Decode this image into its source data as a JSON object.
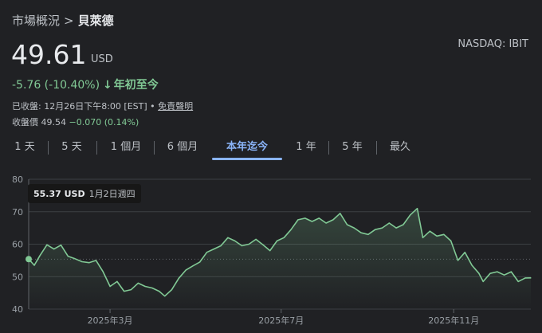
{
  "breadcrumb": {
    "root": "市場概況",
    "separator": ">",
    "current": "貝萊德"
  },
  "ticker": "NASDAQ: IBIT",
  "price": {
    "value": "49.61",
    "currency": "USD"
  },
  "change": {
    "text": "-5.76 (-10.40%)",
    "arrow": "↓",
    "period": "年初至今"
  },
  "closed": {
    "label": "已收盤:",
    "datetime": "12月26日下午8:00 [EST]",
    "separator": "•",
    "disclaimer": "免責聲明"
  },
  "after_hours": {
    "label": "收盤價",
    "value": "49.54",
    "delta": "−0.070 (0.14%)"
  },
  "tabs": [
    {
      "label": "1 天",
      "active": false
    },
    {
      "label": "5 天",
      "active": false
    },
    {
      "label": "1 個月",
      "active": false
    },
    {
      "label": "6 個月",
      "active": false
    },
    {
      "label": "本年迄今",
      "active": true
    },
    {
      "label": "1 年",
      "active": false
    },
    {
      "label": "5 年",
      "active": false
    },
    {
      "label": "最久",
      "active": false
    }
  ],
  "tooltip": {
    "value": "55.37 USD",
    "date": "1月2日週四"
  },
  "colors": {
    "line": "#81c995",
    "accent": "#8ab4f8",
    "background": "#202124",
    "grid": "#3c4043"
  },
  "chart_data": {
    "type": "area",
    "x": [
      "2025-01-02",
      "2025-01-06",
      "2025-01-10",
      "2025-01-15",
      "2025-01-20",
      "2025-01-25",
      "2025-01-30",
      "2025-02-04",
      "2025-02-09",
      "2025-02-14",
      "2025-02-19",
      "2025-02-24",
      "2025-03-01",
      "2025-03-06",
      "2025-03-11",
      "2025-03-16",
      "2025-03-21",
      "2025-03-26",
      "2025-03-31",
      "2025-04-05",
      "2025-04-09",
      "2025-04-14",
      "2025-04-19",
      "2025-04-24",
      "2025-04-29",
      "2025-05-04",
      "2025-05-09",
      "2025-05-14",
      "2025-05-19",
      "2025-05-24",
      "2025-05-29",
      "2025-06-03",
      "2025-06-08",
      "2025-06-13",
      "2025-06-18",
      "2025-06-23",
      "2025-06-28",
      "2025-07-03",
      "2025-07-08",
      "2025-07-13",
      "2025-07-18",
      "2025-07-23",
      "2025-07-28",
      "2025-08-02",
      "2025-08-07",
      "2025-08-12",
      "2025-08-17",
      "2025-08-22",
      "2025-08-27",
      "2025-09-01",
      "2025-09-06",
      "2025-09-11",
      "2025-09-16",
      "2025-09-21",
      "2025-09-26",
      "2025-10-01",
      "2025-10-06",
      "2025-10-10",
      "2025-10-15",
      "2025-10-20",
      "2025-10-25",
      "2025-10-30",
      "2025-11-04",
      "2025-11-09",
      "2025-11-14",
      "2025-11-19",
      "2025-11-22",
      "2025-11-27",
      "2025-12-02",
      "2025-12-07",
      "2025-12-12",
      "2025-12-17",
      "2025-12-22",
      "2025-12-26"
    ],
    "y": [
      55.4,
      53.5,
      56.5,
      59.8,
      58.5,
      59.7,
      56.3,
      55.5,
      54.6,
      54.3,
      55.0,
      51.5,
      47.0,
      48.5,
      45.5,
      46.0,
      48.0,
      47.0,
      46.5,
      45.5,
      44.0,
      46.0,
      49.5,
      52.0,
      53.3,
      54.5,
      57.5,
      58.5,
      59.5,
      62.0,
      61.0,
      59.5,
      60.0,
      61.5,
      59.8,
      58.0,
      61.0,
      62.0,
      64.5,
      67.5,
      68.0,
      67.0,
      68.0,
      66.5,
      67.5,
      69.5,
      66.0,
      65.0,
      63.5,
      63.0,
      64.5,
      65.0,
      66.5,
      65.0,
      66.0,
      69.0,
      71.0,
      62.0,
      64.0,
      62.5,
      63.0,
      61.0,
      55.0,
      57.5,
      53.5,
      51.0,
      48.5,
      51.0,
      51.5,
      50.5,
      51.5,
      48.5,
      49.6,
      49.61
    ],
    "ylim": [
      40,
      80
    ],
    "yticks": [
      40,
      50,
      60,
      70,
      80
    ],
    "xtick_labels": [
      "2025年3月",
      "2025年7月",
      "2025年11月"
    ],
    "xtick_dates": [
      "2025-03-01",
      "2025-07-01",
      "2025-11-01"
    ],
    "reference_value": 55.37,
    "grid": true
  }
}
